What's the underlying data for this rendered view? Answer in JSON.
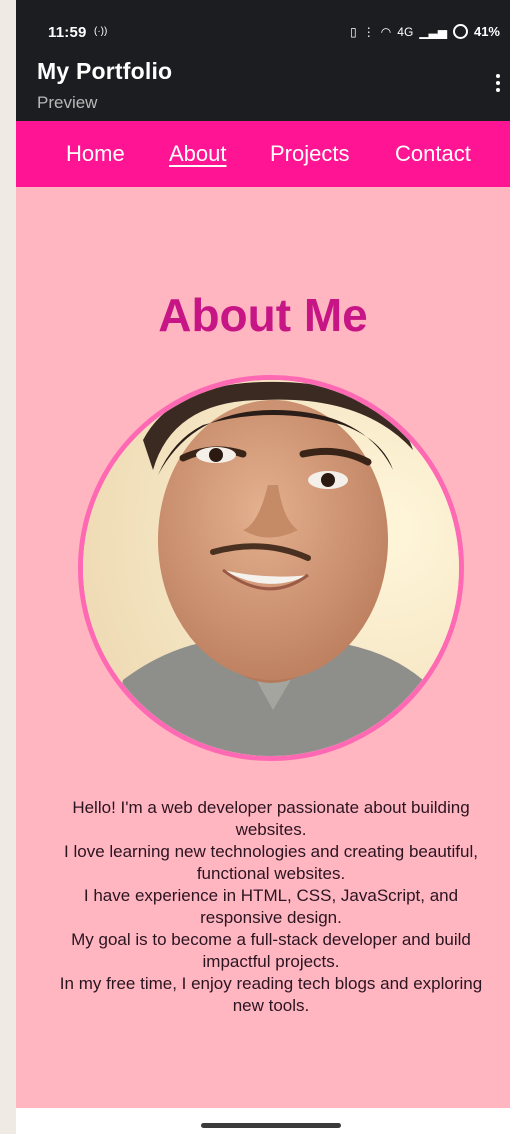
{
  "status_bar": {
    "time": "11:59",
    "hotspot_glyph": "(·))",
    "signal_text": "4G",
    "battery": "41%",
    "icons": [
      "vibrate-icon",
      "volte-icon",
      "hotspot-icon",
      "signal-icon",
      "battery-icon"
    ]
  },
  "app_bar": {
    "title": "My Portfolio",
    "subtitle": "Preview",
    "menu_icon": "more-vert-icon"
  },
  "nav": {
    "items": [
      {
        "label": "Home",
        "active": false
      },
      {
        "label": "About",
        "active": true
      },
      {
        "label": "Projects",
        "active": false
      },
      {
        "label": "Contact",
        "active": false
      }
    ]
  },
  "about": {
    "heading": "About Me",
    "bio": [
      "Hello! I'm a web developer passionate about building websites.",
      "I love learning new technologies and creating beautiful, functional websites.",
      "I have experience in HTML, CSS, JavaScript, and responsive design.",
      "My goal is to become a full-stack developer and build impactful projects.",
      "In my free time, I enjoy reading tech blogs and exploring new tools."
    ]
  },
  "colors": {
    "nav_bg": "#ff1493",
    "page_bg": "#ffb6c1",
    "heading": "#c71585",
    "photo_border": "#ff69b4",
    "app_bar_bg": "#1c1d20"
  }
}
